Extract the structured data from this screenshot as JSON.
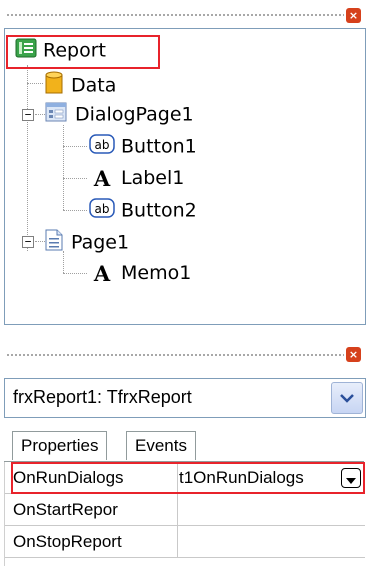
{
  "report_tree": {
    "items": [
      {
        "label": "Report",
        "icon": "report-icon"
      },
      {
        "label": "Data",
        "icon": "database-icon"
      },
      {
        "label": "DialogPage1",
        "icon": "dialog-page-icon"
      },
      {
        "label": "Button1",
        "icon": "button-ab-icon"
      },
      {
        "label": "Label1",
        "icon": "label-a-icon"
      },
      {
        "label": "Button2",
        "icon": "button-ab-icon"
      },
      {
        "label": "Page1",
        "icon": "page-icon"
      },
      {
        "label": "Memo1",
        "icon": "memo-a-icon"
      }
    ],
    "toggles": {
      "collapse": "−"
    }
  },
  "close_glyph": "×",
  "object_selector": {
    "value": "frxReport1: TfrxReport"
  },
  "inspector": {
    "tabs": [
      "Properties",
      "Events"
    ],
    "rows": [
      {
        "name": "OnRunDialogs",
        "value": "t1OnRunDialogs"
      },
      {
        "name": "OnStartRepor",
        "value": ""
      },
      {
        "name": "OnStopReport",
        "value": ""
      }
    ]
  },
  "colors": {
    "highlight": "#e8232b",
    "close": "#d6411c"
  }
}
